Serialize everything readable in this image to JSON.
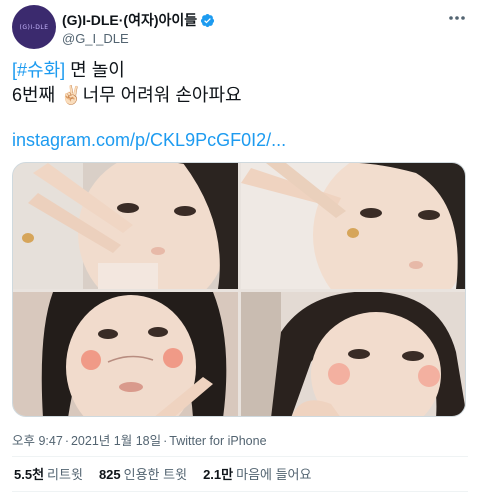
{
  "author": {
    "display_name": "(G)I-DLE·(여자)아이들",
    "handle": "@G_I_DLE",
    "avatar_text": "(G)I-DLE"
  },
  "tweet": {
    "hashtag": "[#슈화]",
    "line1_rest": " 면 놀이",
    "line2_a": "6번째 ",
    "line2_emoji": "✌🏻",
    "line2_b": "너무 어려워 손아파요",
    "link": "instagram.com/p/CKL9PcGF0I2/..."
  },
  "meta": {
    "time": "오후 9:47",
    "date": "2021년 1월 18일",
    "source": "Twitter for iPhone"
  },
  "stats": {
    "retweets_num": "5.5천",
    "retweets_label": "리트윗",
    "quotes_num": "825",
    "quotes_label": "인용한 트윗",
    "likes_num": "2.1만",
    "likes_label": "마음에 들어요"
  },
  "colors": {
    "link": "#1d9bf0",
    "secondary_text": "#536471",
    "verified": "#1d9bf0"
  }
}
